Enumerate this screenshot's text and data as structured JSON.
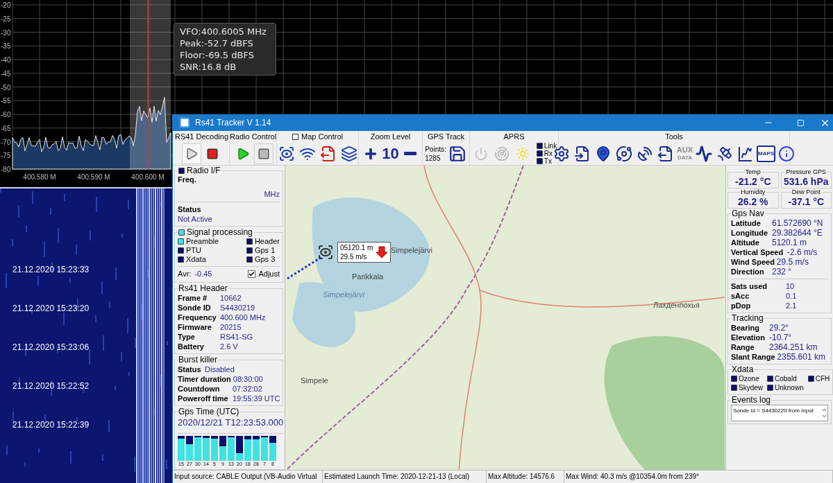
{
  "spectrum": {
    "y_ticks": [
      "-20",
      "-25",
      "-30",
      "-35",
      "-40",
      "-45",
      "-50",
      "-55",
      "-60",
      "-65",
      "-70",
      "-75",
      "-80"
    ],
    "x_ticks": [
      "400.580 M",
      "400.590 M",
      "400.600 M"
    ],
    "readout": [
      "VFO:400.6005 MHz",
      "Peak:-52.7 dBFS",
      "Floor:-69.5 dBFS",
      "SNR:16.8 dB"
    ]
  },
  "waterfall": {
    "timestamps": [
      "21.12.2020 15:23:33",
      "21.12.2020 15:23:20",
      "21.12.2020 15:23:06",
      "21.12.2020 15:22:52",
      "21.12.2020 15:22:39"
    ]
  },
  "window": {
    "title": "Rs41 Tracker V 1.14"
  },
  "toolbar": {
    "decoding": {
      "title": "RS41 Decoding"
    },
    "radio": {
      "title": "Radio Control"
    },
    "map_control": {
      "title": "Map Control",
      "checked": false
    },
    "zoom": {
      "title": "Zoom Level",
      "value": "10"
    },
    "gps_track": {
      "title": "GPS Track",
      "points_label": "Points:",
      "points": "1285"
    },
    "aprs": {
      "title": "APRS",
      "indicators": [
        {
          "label": "Link",
          "on": false
        },
        {
          "label": "Rx",
          "on": false
        },
        {
          "label": "Tx",
          "on": false
        }
      ]
    },
    "tools": {
      "title": "Tools",
      "aux_label": "AUX",
      "aux_sub": "DATA",
      "maps_label": "MAPS"
    }
  },
  "radio_if": {
    "title": "Radio  I/F",
    "on": false,
    "freq_label": "Freq.",
    "freq_unit": "MHz",
    "status_label": "Status",
    "status": "Not Active"
  },
  "signal_processing": {
    "title": "Signal processing",
    "on": true,
    "flags": [
      {
        "label": "Preamble",
        "on": true
      },
      {
        "label": "Header",
        "on": false
      },
      {
        "label": "PTU",
        "on": false
      },
      {
        "label": "Gps 1",
        "on": false
      },
      {
        "label": "Xdata",
        "on": false
      },
      {
        "label": "Gps 3",
        "on": false
      }
    ],
    "avr_label": "Avr:",
    "avr": "-0.45",
    "adjust": {
      "label": "Adjust",
      "checked": true
    }
  },
  "rs41_header": {
    "title": "Rs41 Header",
    "rows": [
      {
        "label": "Frame #",
        "value": "10662"
      },
      {
        "label": "Sonde ID",
        "value": "S4430219"
      },
      {
        "label": "Frequency",
        "value": "400.600 MHz"
      },
      {
        "label": "Firmware",
        "value": "20215"
      },
      {
        "label": "Type",
        "value": "RS41-SG"
      },
      {
        "label": "Battery",
        "value": "2.6 V"
      }
    ]
  },
  "burst_killer": {
    "title": "Burst killer",
    "rows": [
      {
        "label": "Status",
        "value": "Disabled"
      },
      {
        "label": "Timer duration",
        "value": "08:30:00"
      },
      {
        "label": "Countdown",
        "value": "07:32:02"
      },
      {
        "label": "Poweroff time",
        "value": "19:55:39 UTC"
      }
    ]
  },
  "gps_time": {
    "title": "Gps Time (UTC)",
    "value": "2020/12/21 T12:23:53.000",
    "sats": [
      {
        "label": "15",
        "level": 0.88
      },
      {
        "label": "27",
        "level": 0.66
      },
      {
        "label": "30",
        "level": 0.92
      },
      {
        "label": "14",
        "level": 0.9
      },
      {
        "label": "5",
        "level": 0.88
      },
      {
        "label": "9",
        "level": 0.57
      },
      {
        "label": "13",
        "level": 0.92
      },
      {
        "label": "20",
        "level": 0.28
      },
      {
        "label": "18",
        "level": 0.86
      },
      {
        "label": "28",
        "level": 0.86
      },
      {
        "label": "7",
        "level": 0.92
      },
      {
        "label": "8",
        "level": 0.7
      }
    ]
  },
  "map": {
    "labels": [
      "Simpelejärvi",
      "Parikkala",
      "Simpelejärvi",
      "Лахденпохья",
      "Simpele"
    ],
    "marker": {
      "altitude": "05120.1 m",
      "speed": "29.5 m/s"
    }
  },
  "readouts": [
    {
      "label": "Temp",
      "value": "-21.2 °C"
    },
    {
      "label": "Pressure GPS",
      "value": "531.6 hPa"
    },
    {
      "label": "Humidity",
      "value": "26.2 %"
    },
    {
      "label": "Dew Point",
      "value": "-37.1 °C"
    }
  ],
  "gps_nav": {
    "title": "Gps Nav",
    "rows": [
      {
        "label": "Latitude",
        "value": "61.572690 °N"
      },
      {
        "label": "Longitude",
        "value": "29.382644 °E"
      },
      {
        "label": "Altitude",
        "value": "5120.1 m"
      },
      {
        "label": "Vertical Speed",
        "value": "-2.6 m/s"
      },
      {
        "label": "Wind Speed",
        "value": "29.5 m/s"
      },
      {
        "label": "Direction",
        "value": "232 °"
      }
    ],
    "rows2": [
      {
        "label": "Sats used",
        "value": "10"
      },
      {
        "label": "sAcc",
        "value": "0.1"
      },
      {
        "label": "pDop",
        "value": "2.1"
      }
    ]
  },
  "tracking": {
    "title": "Tracking",
    "rows": [
      {
        "label": "Bearing",
        "value": "29.2°"
      },
      {
        "label": "Elevation",
        "value": "-10.7°"
      },
      {
        "label": "Range",
        "value": "2364.251 km"
      },
      {
        "label": "Slant Range",
        "value": "2355.601 km"
      }
    ]
  },
  "xdata": {
    "title": "Xdata",
    "flags": [
      {
        "label": "Ozone",
        "on": false
      },
      {
        "label": "Cobald",
        "on": false
      },
      {
        "label": "CFH",
        "on": false
      },
      {
        "label": "Skydew",
        "on": false
      },
      {
        "label": "Unknown",
        "on": false
      }
    ]
  },
  "events_log": {
    "title": "Events log",
    "text": "Sonde Id = S4430220 from Input"
  },
  "status_bar": [
    "Input source: CABLE Output (VB-Audio Virtual",
    "Estimated Launch Time: 2020-12-21-13 (Local)",
    "Max Altitude: 14576.6",
    "Max Wind: 40.3 m/s @10354.0m from 239°"
  ]
}
